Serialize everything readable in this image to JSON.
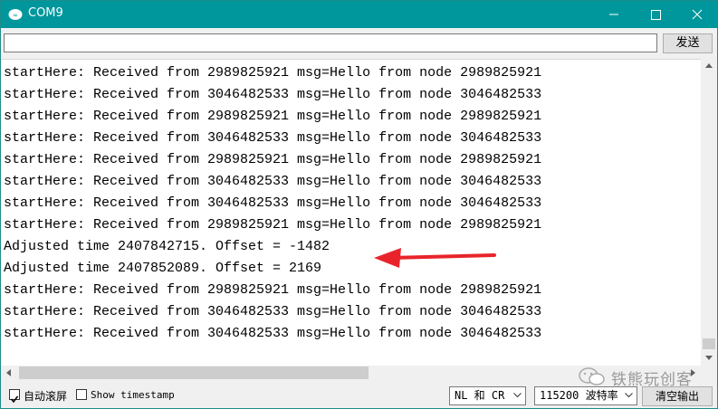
{
  "window": {
    "title": "COM9",
    "minimize_icon": "minimize-icon",
    "maximize_icon": "maximize-icon",
    "close_icon": "close-icon",
    "accent": "#00979c"
  },
  "input": {
    "value": "",
    "send_label": "发送"
  },
  "output": {
    "lines": [
      "startHere: Received from 2989825921 msg=Hello from node 2989825921",
      "startHere: Received from 3046482533 msg=Hello from node 3046482533",
      "startHere: Received from 2989825921 msg=Hello from node 2989825921",
      "startHere: Received from 3046482533 msg=Hello from node 3046482533",
      "startHere: Received from 2989825921 msg=Hello from node 2989825921",
      "startHere: Received from 3046482533 msg=Hello from node 3046482533",
      "startHere: Received from 3046482533 msg=Hello from node 3046482533",
      "startHere: Received from 2989825921 msg=Hello from node 2989825921",
      "Adjusted time 2407842715. Offset = -1482",
      "Adjusted time 2407852089. Offset = 2169",
      "startHere: Received from 2989825921 msg=Hello from node 2989825921",
      "startHere: Received from 3046482533 msg=Hello from node 3046482533",
      "startHere: Received from 3046482533 msg=Hello from node 3046482533"
    ],
    "annotation_color": "#e8242a"
  },
  "status": {
    "autoscroll_label": "自动滚屏",
    "autoscroll_checked": true,
    "timestamp_label": "Show timestamp",
    "timestamp_checked": false,
    "line_ending": "NL 和 CR",
    "baud": "115200 波特率",
    "clear_label": "清空输出"
  },
  "watermark": {
    "text": "铁熊玩创客"
  }
}
